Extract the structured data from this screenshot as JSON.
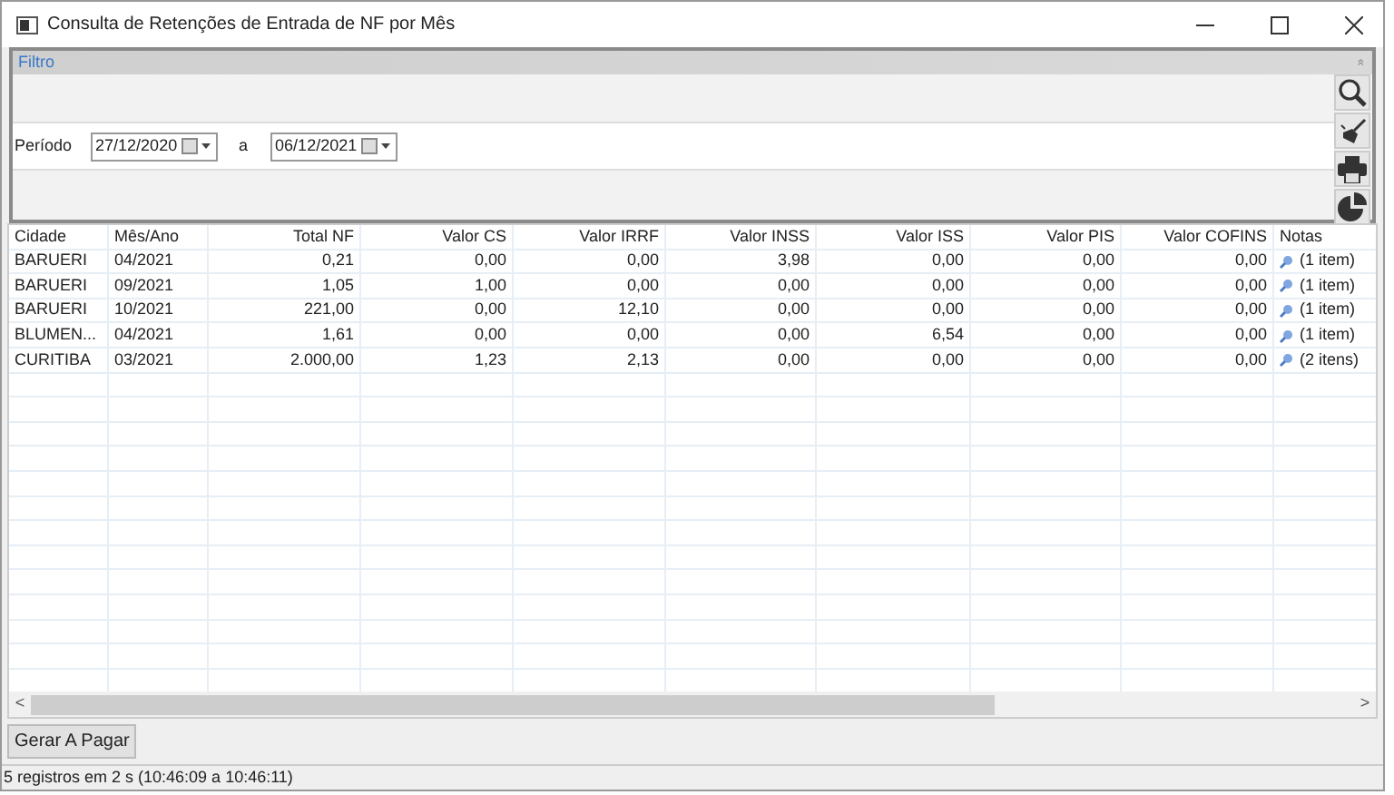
{
  "window": {
    "title": "Consulta de Retenções de Entrada de NF por Mês"
  },
  "filter": {
    "title": "Filtro",
    "collapse_glyph": "»",
    "period_label": "Período",
    "date_from": "27/12/2020",
    "separator": "a",
    "date_to": "06/12/2021"
  },
  "table": {
    "columns": [
      "Cidade",
      "Mês/Ano",
      "Total NF",
      "Valor CS",
      "Valor IRRF",
      "Valor INSS",
      "Valor ISS",
      "Valor PIS",
      "Valor COFINS",
      "Notas"
    ],
    "rows": [
      [
        "BARUERI",
        "04/2021",
        "0,21",
        "0,00",
        "0,00",
        "3,98",
        "0,00",
        "0,00",
        "0,00",
        "(1 item)"
      ],
      [
        "BARUERI",
        "09/2021",
        "1,05",
        "1,00",
        "0,00",
        "0,00",
        "0,00",
        "0,00",
        "0,00",
        "(1 item)"
      ],
      [
        "BARUERI",
        "10/2021",
        "221,00",
        "0,00",
        "12,10",
        "0,00",
        "0,00",
        "0,00",
        "0,00",
        "(1 item)"
      ],
      [
        "BLUMEN...",
        "04/2021",
        "1,61",
        "0,00",
        "0,00",
        "0,00",
        "6,54",
        "0,00",
        "0,00",
        "(1 item)"
      ],
      [
        "CURITIBA",
        "03/2021",
        "2.000,00",
        "1,23",
        "2,13",
        "0,00",
        "0,00",
        "0,00",
        "0,00",
        "(2 itens)"
      ]
    ]
  },
  "scroll_left": "<",
  "scroll_right": ">",
  "button": "Gerar A Pagar",
  "status_bar": "5 registros em 2 s (10:46:09 a 10:46:11)"
}
